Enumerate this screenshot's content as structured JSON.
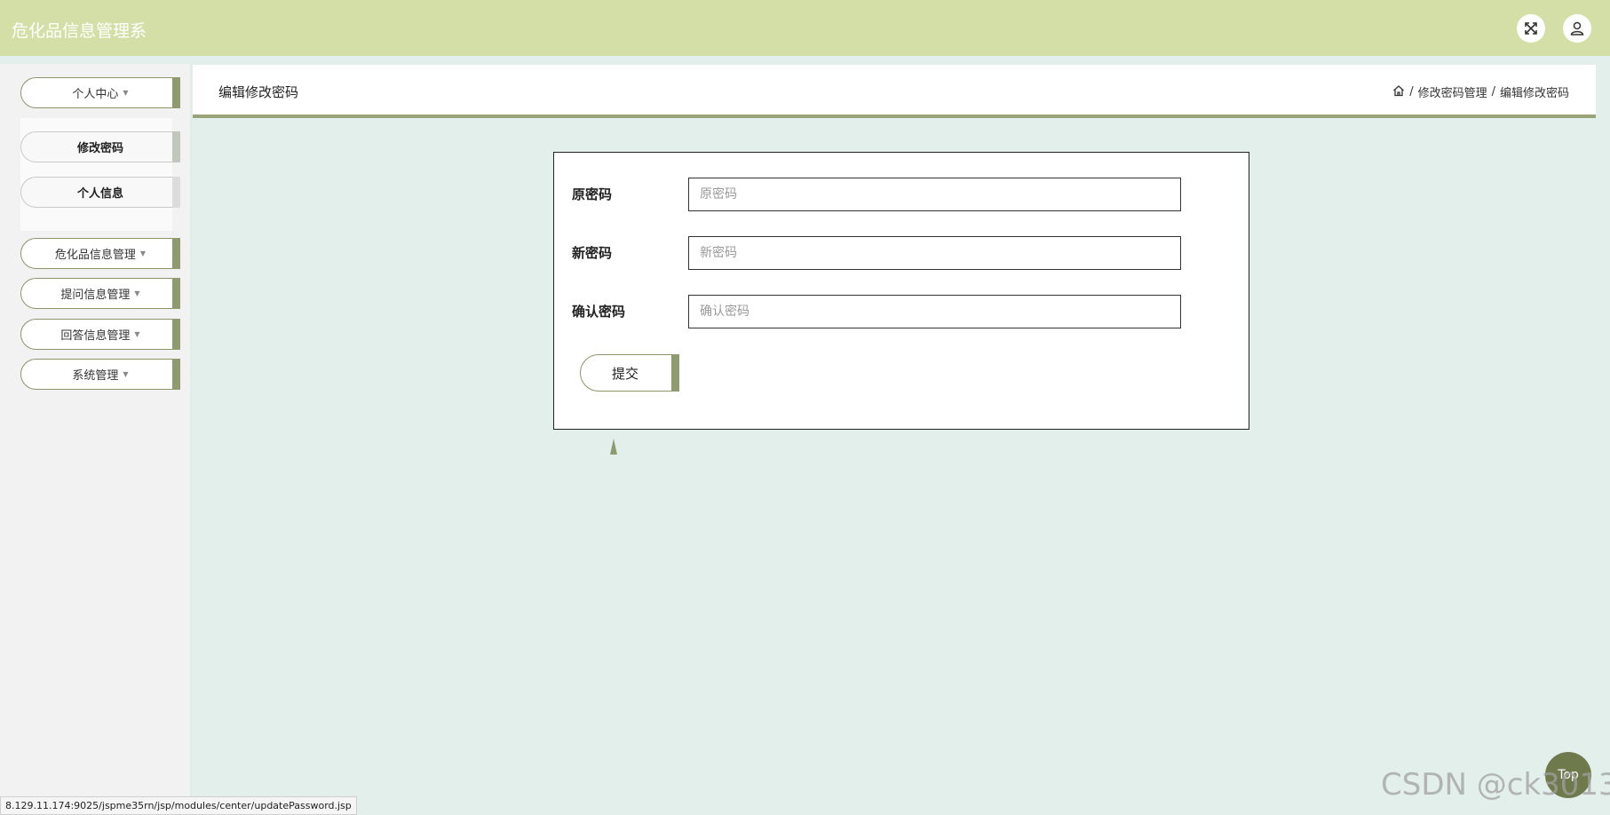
{
  "header": {
    "title": "危化品信息管理系",
    "fullscreen_icon": "expand-icon",
    "user_icon": "user-icon"
  },
  "sidebar": {
    "personal_center": "个人中心",
    "sub_items": [
      {
        "label": "修改密码"
      },
      {
        "label": "个人信息"
      }
    ],
    "menus": [
      {
        "label": "危化品信息管理"
      },
      {
        "label": "提问信息管理"
      },
      {
        "label": "回答信息管理"
      },
      {
        "label": "系统管理"
      }
    ]
  },
  "breadcrumb": {
    "title": "编辑修改密码",
    "home_icon": "home-icon",
    "sep": "/",
    "path1": "修改密码管理",
    "path2": "编辑修改密码"
  },
  "form": {
    "old_password_label": "原密码",
    "old_password_placeholder": "原密码",
    "new_password_label": "新密码",
    "new_password_placeholder": "新密码",
    "confirm_password_label": "确认密码",
    "confirm_password_placeholder": "确认密码",
    "submit_label": "提交"
  },
  "back_to_top": "Top",
  "watermark": "CSDN @ck3013",
  "status_url": "8.129.11.174:9025/jspme35rn/jsp/modules/center/updatePassword.jsp",
  "colors": {
    "header_bg": "#d4dfa8",
    "accent": "#8f9a6e",
    "page_bg": "#e3efeb"
  }
}
